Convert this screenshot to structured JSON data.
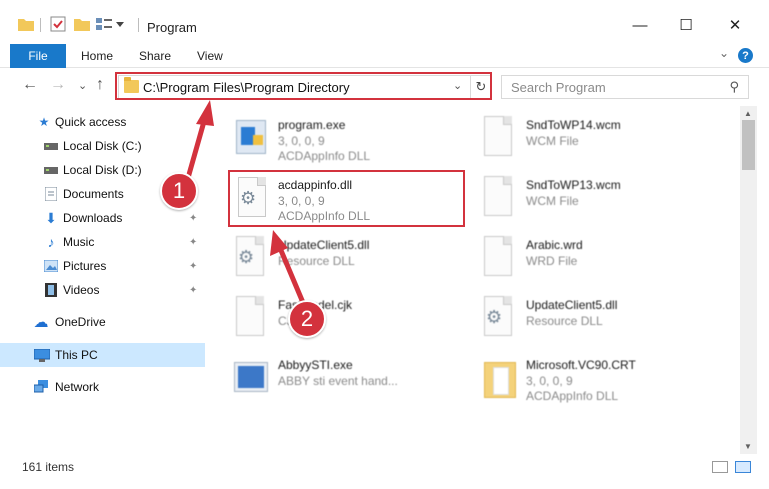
{
  "window": {
    "title": "Program",
    "minimize_glyph": "—",
    "maximize_glyph": "☐",
    "close_glyph": "✕"
  },
  "ribbon": {
    "tabs": [
      "File",
      "Home",
      "Share",
      "View"
    ],
    "collapse_glyph": "⌄",
    "help_glyph": "?"
  },
  "nav": {
    "back_glyph": "←",
    "forward_glyph": "→",
    "recent_glyph": "⌄",
    "up_glyph": "↑",
    "address": "C:\\Program Files\\Program Directory",
    "address_dropdown_glyph": "⌄",
    "refresh_glyph": "↻",
    "search_placeholder": "Search Program",
    "search_glyph": "⚲"
  },
  "sidebar": {
    "items": [
      {
        "label": "Quick access",
        "icon": "star-icon",
        "glyph": "★",
        "color": "#2b7cd3",
        "pinned": false
      },
      {
        "label": "Local Disk (C:)",
        "icon": "drive-icon",
        "glyph": "▬",
        "color": "#555555",
        "pinned": false
      },
      {
        "label": "Local Disk (D:)",
        "icon": "drive-icon",
        "glyph": "▬",
        "color": "#555555",
        "pinned": false
      },
      {
        "label": "Documents",
        "icon": "documents-icon",
        "glyph": "▤",
        "color": "#6b7c8f",
        "pinned": true
      },
      {
        "label": "Downloads",
        "icon": "downloads-icon",
        "glyph": "⬇",
        "color": "#2b7cd3",
        "pinned": true
      },
      {
        "label": "Music",
        "icon": "music-icon",
        "glyph": "♪",
        "color": "#2b7cd3",
        "pinned": true
      },
      {
        "label": "Pictures",
        "icon": "pictures-icon",
        "glyph": "▣",
        "color": "#4a8bd1",
        "pinned": true
      },
      {
        "label": "Videos",
        "icon": "videos-icon",
        "glyph": "▦",
        "color": "#444444",
        "pinned": true
      },
      {
        "label": "OneDrive",
        "icon": "onedrive-icon",
        "glyph": "☁",
        "color": "#1f6fd1",
        "pinned": false
      },
      {
        "label": "This PC",
        "icon": "computer-icon",
        "glyph": "▭",
        "color": "#2b7cd3",
        "pinned": false
      },
      {
        "label": "Network",
        "icon": "network-icon",
        "glyph": "▩",
        "color": "#2b7cd3",
        "pinned": false
      }
    ],
    "pin_glyph": "📌"
  },
  "files": {
    "program_exe": {
      "name": "program.exe",
      "line1": "3, 0, 0, 9",
      "line2": "ACDAppInfo DLL"
    },
    "acdappinfo": {
      "name": "acdappinfo.dll",
      "line1": "3, 0, 0, 9",
      "line2": "ACDAppInfo DLL"
    },
    "updateclient5_left": {
      "name": "UpdateClient5.dll",
      "line1": "Resource DLL"
    },
    "fastmodel": {
      "name": "Fastmodel.cjk",
      "line1": "CJK File"
    },
    "abbyysti": {
      "name": "AbbyySTI.exe",
      "line1": "ABBY sti event hand..."
    },
    "sndtowp14": {
      "name": "SndToWP14.wcm",
      "line1": "WCM File"
    },
    "sndtowp13": {
      "name": "SndToWP13.wcm",
      "line1": "WCM File"
    },
    "arabic": {
      "name": "Arabic.wrd",
      "line1": "WRD File"
    },
    "updateclient5_right": {
      "name": "UpdateClient5.dll",
      "line1": "Resource DLL"
    },
    "msvc90": {
      "name": "Microsoft.VC90.CRT",
      "line1": "3, 0, 0, 9",
      "line2": "ACDAppInfo DLL"
    }
  },
  "status": {
    "items_count": "161 items"
  },
  "callouts": {
    "one": "1",
    "two": "2"
  },
  "colors": {
    "accent": "#1979ca",
    "highlight_red": "#d3323d",
    "selection": "#cce8ff"
  }
}
